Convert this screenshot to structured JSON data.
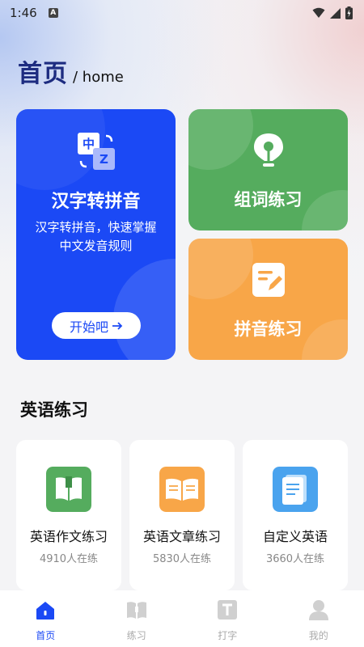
{
  "status_bar": {
    "time": "1:46",
    "notification_badge": "A"
  },
  "header": {
    "title": "首页",
    "subtitle": "/ home"
  },
  "colors": {
    "primary_blue": "#1b49f5",
    "green": "#55ac5e",
    "orange": "#f8a648",
    "title_navy": "#1d2c80"
  },
  "features": {
    "hanzi": {
      "title": "汉字转拼音",
      "description": "汉字转拼音，快速掌握中文发音规则",
      "button_label": "开始吧",
      "icon": "translate-icon"
    },
    "word_building": {
      "title": "组词练习",
      "icon": "pen-nib-icon"
    },
    "pinyin": {
      "title": "拼音练习",
      "icon": "edit-note-icon"
    }
  },
  "english_section": {
    "title": "英语练习",
    "items": [
      {
        "title": "英语作文练习",
        "count": "4910人在练",
        "icon": "book-icon",
        "color": "#55ac5e"
      },
      {
        "title": "英语文章练习",
        "count": "5830人在练",
        "icon": "open-book-icon",
        "color": "#f8a648"
      },
      {
        "title": "自定义英语",
        "count": "3660人在练",
        "icon": "notebook-icon",
        "color": "#4aa3ee"
      }
    ]
  },
  "bottom_nav": {
    "items": [
      {
        "label": "首页",
        "icon": "home-icon",
        "active": true
      },
      {
        "label": "练习",
        "icon": "practice-book-icon",
        "active": false
      },
      {
        "label": "打字",
        "icon": "typing-icon",
        "active": false
      },
      {
        "label": "我的",
        "icon": "profile-icon",
        "active": false
      }
    ]
  }
}
